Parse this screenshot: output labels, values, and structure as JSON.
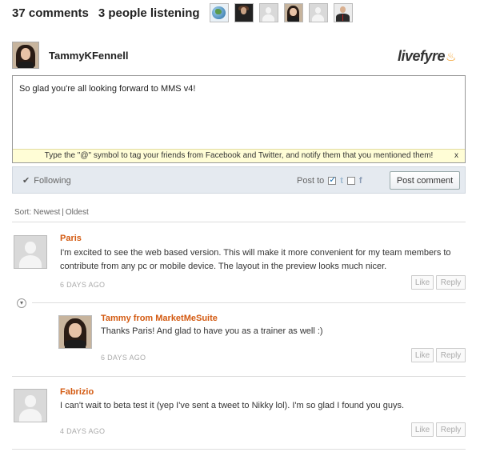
{
  "header": {
    "comments_count": "37 comments",
    "listening": "3 people listening"
  },
  "listeners": [
    {
      "icon": "globe-avatar"
    },
    {
      "icon": "person-dark-avatar"
    },
    {
      "icon": "generic-avatar"
    },
    {
      "icon": "woman-avatar"
    },
    {
      "icon": "generic-avatar"
    },
    {
      "icon": "man-suit-avatar"
    }
  ],
  "composer": {
    "username": "TammyKFennell",
    "brand": "livefyre",
    "text": "So glad you're all looking forward to MMS v4!",
    "tip": "Type the \"@\" symbol to tag your friends from Facebook and Twitter, and notify them that you mentioned them!",
    "tip_close": "x",
    "following_label": "Following",
    "post_to_label": "Post to",
    "post_button": "Post comment"
  },
  "sort": {
    "label": "Sort:",
    "newest": "Newest",
    "separator": "|",
    "oldest": "Oldest"
  },
  "comments": [
    {
      "author": "Paris",
      "body": "I'm excited to see the web based version. This will make it more convenient for my team members to contribute from any pc or mobile device. The layout in the preview looks much nicer.",
      "time": "6 DAYS AGO",
      "like": "Like",
      "reply": "Reply"
    },
    {
      "author": "Tammy from MarketMeSuite",
      "body": "Thanks Paris! And glad to have you as a trainer as well :)",
      "time": "6 DAYS AGO",
      "like": "Like",
      "reply": "Reply"
    },
    {
      "author": "Fabrizio",
      "body": "I can't wait to beta test it (yep I've sent a tweet to Nikky lol). I'm so glad I found you guys.",
      "time": "4 DAYS AGO",
      "like": "Like",
      "reply": "Reply"
    }
  ],
  "colors": {
    "author": "#d35a11",
    "bar_bg": "#e5eaf0",
    "tip_bg": "#fffdd6",
    "brand_flame": "#f29a1f"
  }
}
